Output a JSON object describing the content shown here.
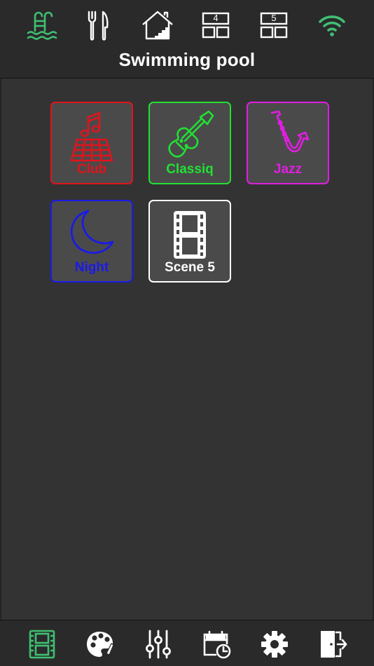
{
  "colors": {
    "active": "#3fbf72",
    "icon": "#ffffff",
    "club": "#e0141c",
    "classiq": "#22e033",
    "jazz": "#e01ee0",
    "night": "#1a1ae8",
    "scene5": "#ffffff"
  },
  "header": {
    "title": "Swimming pool",
    "nav": [
      {
        "icon": "pool-ladder-icon",
        "active": true
      },
      {
        "icon": "fork-knife-icon",
        "active": false
      },
      {
        "icon": "house-stairs-icon",
        "active": false
      },
      {
        "icon": "floor-4-icon",
        "label": "4",
        "active": false
      },
      {
        "icon": "floor-5-icon",
        "label": "5",
        "active": false
      },
      {
        "icon": "wifi-icon",
        "active": true
      }
    ]
  },
  "scenes": [
    {
      "label": "Club",
      "icon": "dancefloor-music-icon"
    },
    {
      "label": "Classiq",
      "icon": "violin-icon"
    },
    {
      "label": "Jazz",
      "icon": "saxophone-icon"
    },
    {
      "label": "Night",
      "icon": "moon-icon"
    },
    {
      "label": "Scene 5",
      "icon": "film-icon"
    }
  ],
  "bottom_nav": [
    {
      "icon": "film-icon",
      "active": true
    },
    {
      "icon": "palette-icon",
      "active": false
    },
    {
      "icon": "sliders-icon",
      "active": false
    },
    {
      "icon": "calendar-clock-icon",
      "active": false
    },
    {
      "icon": "gear-icon",
      "active": false
    },
    {
      "icon": "logout-door-icon",
      "active": false
    }
  ]
}
